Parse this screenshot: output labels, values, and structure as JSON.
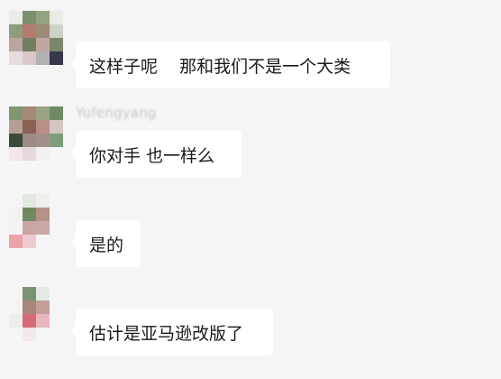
{
  "messages": [
    {
      "sender": "",
      "text": "这样子呢    那和我们不是一个大类"
    },
    {
      "sender": "Yufengyang",
      "text": "你对手 也一样么"
    },
    {
      "sender": "",
      "text": "是的"
    },
    {
      "sender": "",
      "text": "估计是亚马逊改版了"
    }
  ],
  "colors": {
    "background": "#f5f5f5",
    "bubble": "#ffffff",
    "text": "#1a1a1a",
    "sender_name": "#c6c6c6"
  }
}
